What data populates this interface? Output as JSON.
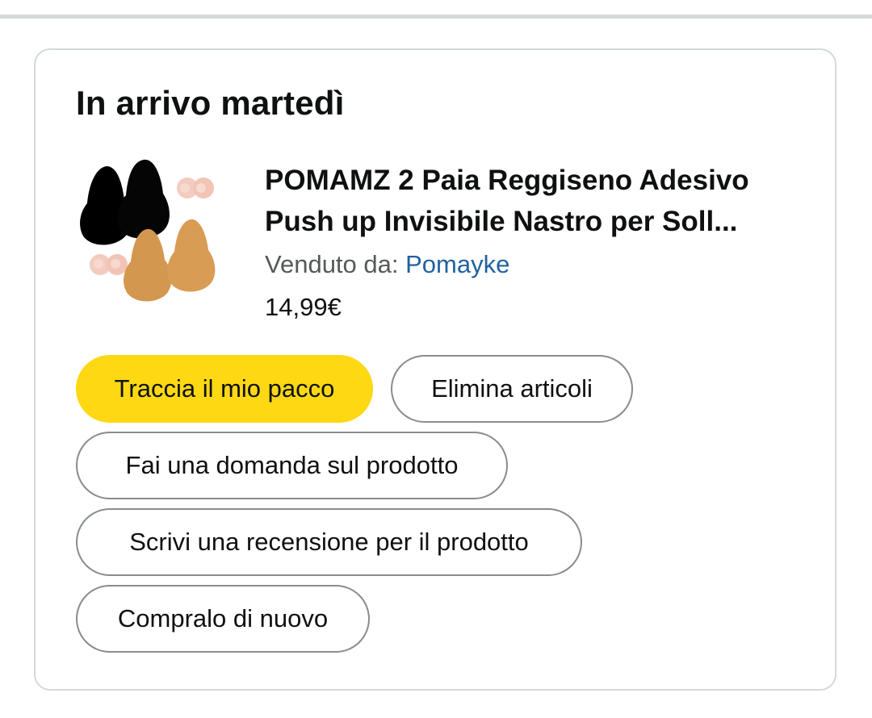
{
  "delivery": {
    "title": "In arrivo martedì"
  },
  "product": {
    "title": "POMAMZ 2 Paia Reggiseno Adesivo Push up Invisibile Nastro per Soll...",
    "seller_label": "Venduto da:",
    "seller_name": "Pomayke",
    "price": "14,99€",
    "image_icon": "product-thumbnail"
  },
  "actions": {
    "track_label": "Traccia il mio pacco",
    "delete_label": "Elimina articoli",
    "ask_label": "Fai una domanda sul prodotto",
    "review_label": "Scrivi una recensione per il prodotto",
    "buy_again_label": "Compralo di nuovo"
  },
  "colors": {
    "primary_button": "#ffd814",
    "link": "#2162a1",
    "muted_text": "#565959",
    "border": "#d5d9d9"
  }
}
